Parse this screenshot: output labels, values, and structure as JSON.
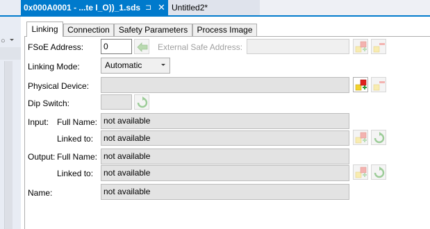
{
  "doc_tabs": {
    "active": {
      "title": "0x000A0001 - ...te I_O))_1.sds",
      "pin_glyph": "⊐",
      "close_glyph": "✕"
    },
    "inactive": {
      "title": "Untitled2*"
    }
  },
  "left_pane": {
    "combo_glyph": "○"
  },
  "tabs": [
    {
      "label": "Linking"
    },
    {
      "label": "Connection"
    },
    {
      "label": "Safety Parameters"
    },
    {
      "label": "Process Image"
    }
  ],
  "form": {
    "fsoe_address": {
      "label": "FSoE Address:",
      "value": "0"
    },
    "external_safe_address": {
      "label": "External Safe Address:",
      "value": ""
    },
    "linking_mode": {
      "label": "Linking Mode:",
      "value": "Automatic"
    },
    "physical_device": {
      "label": "Physical Device:",
      "value": ""
    },
    "dip_switch": {
      "label": "Dip Switch:",
      "value": ""
    },
    "input": {
      "label": "Input:",
      "full_name_label": "Full Name:",
      "full_name_value": "not available",
      "linked_to_label": "Linked to:",
      "linked_to_value": "not available"
    },
    "output": {
      "label": "Output:",
      "full_name_label": "Full Name:",
      "full_name_value": "not available",
      "linked_to_label": "Linked to:",
      "linked_to_value": "not available"
    },
    "name": {
      "label": "Name:",
      "value": "not available"
    }
  },
  "icons": {
    "arrow_left": "arrow-left-icon",
    "refresh": "refresh-icon",
    "link_add": "link-add-icon",
    "link_remove": "link-remove-icon"
  },
  "colors": {
    "active_tab_bg": "#007acc",
    "field_bg": "#e3e3e3",
    "link_red": "#e0201c",
    "link_yellow": "#f2d22e",
    "refresh_green": "#3aa64b"
  }
}
